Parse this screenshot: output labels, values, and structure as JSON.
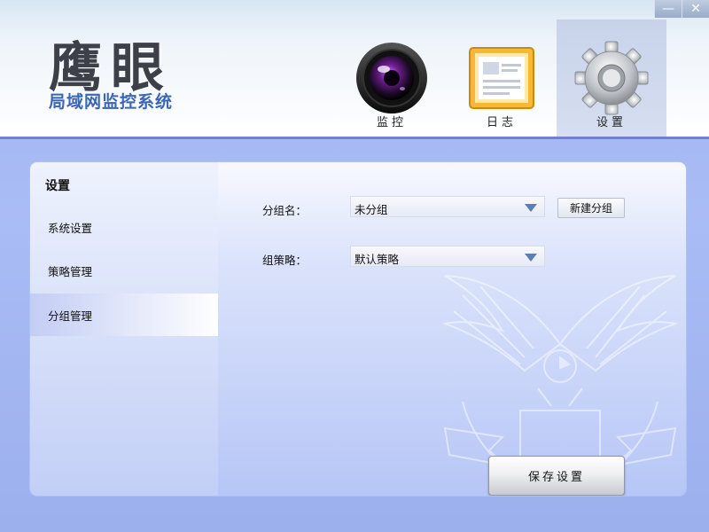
{
  "window": {
    "minimize_glyph": "—",
    "close_glyph": "✕"
  },
  "brand": {
    "title": "鹰眼",
    "subtitle": "局域网监控系统"
  },
  "nav": {
    "tabs": [
      {
        "label": "监控",
        "icon": "camera-lens-icon",
        "active": false
      },
      {
        "label": "日志",
        "icon": "log-book-icon",
        "active": false
      },
      {
        "label": "设置",
        "icon": "gear-icon",
        "active": true
      }
    ]
  },
  "sidebar": {
    "title": "设置",
    "items": [
      {
        "label": "系统设置",
        "active": false
      },
      {
        "label": "策略管理",
        "active": false
      },
      {
        "label": "分组管理",
        "active": true
      }
    ]
  },
  "form": {
    "group_name_label": "分组名：",
    "group_name_value": "未分组",
    "new_group_button": "新建分组",
    "policy_label": "组策略：",
    "policy_value": "默认策略",
    "save_button": "保存设置"
  },
  "colors": {
    "accent": "#6f83cc",
    "background": "#a9bcf5",
    "arrow": "#5a7fb0"
  },
  "decor": {
    "watermark_icon": "eagle-emblem-icon"
  }
}
